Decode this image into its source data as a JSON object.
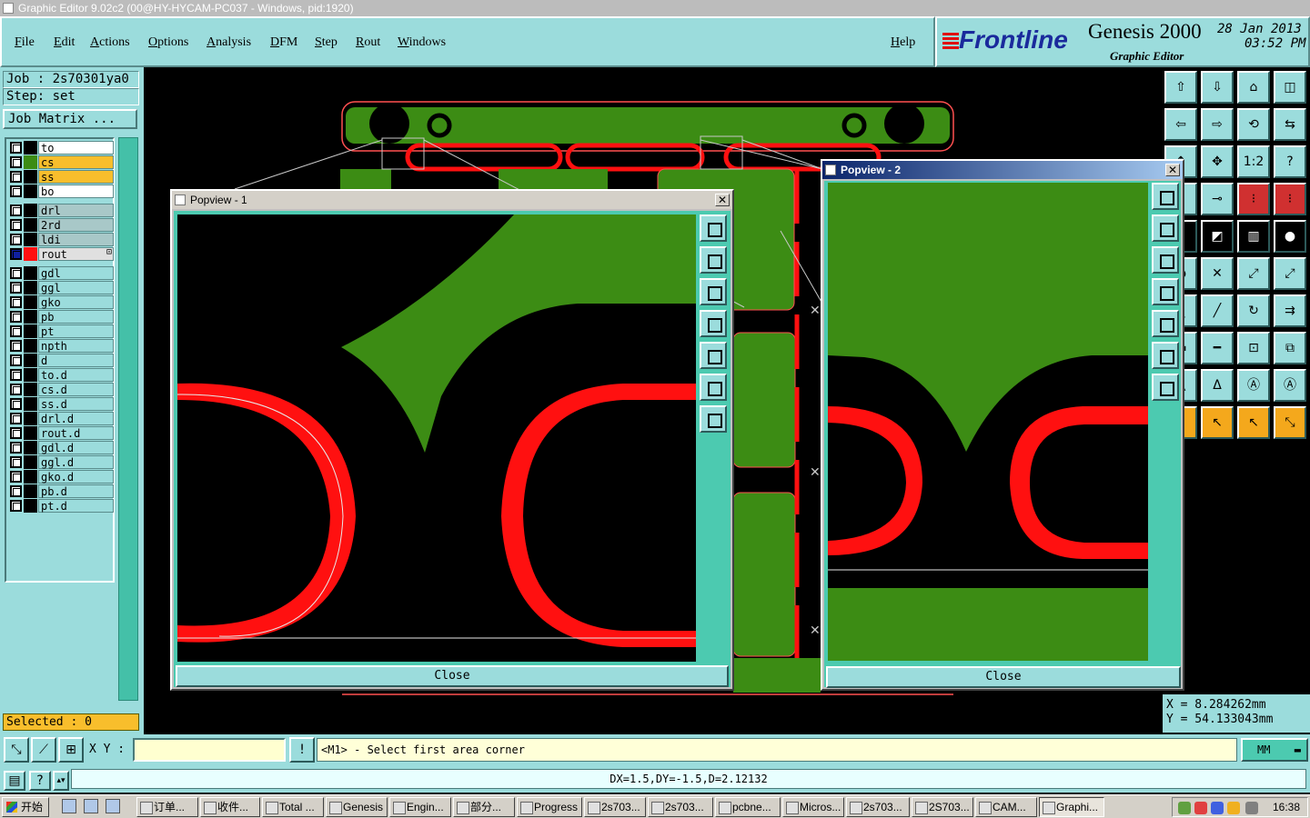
{
  "window": {
    "title": "Graphic Editor 9.02c2 (00@HY-HYCAM-PC037 - Windows, pid:1920)"
  },
  "menu": {
    "items": [
      "File",
      "Edit",
      "Actions",
      "Options",
      "Analysis",
      "DFM",
      "Step",
      "Rout",
      "Windows"
    ],
    "help": "Help"
  },
  "brand": {
    "logo": "Frontline",
    "product": "Genesis 2000",
    "subtitle": "Graphic Editor",
    "date": "28 Jan 2013",
    "time": "03:52 PM"
  },
  "job": {
    "job_line": "Job : 2s70301ya0",
    "step_line": "Step: set",
    "matrix_button": "Job Matrix ..."
  },
  "layers": {
    "group1": [
      {
        "name": "to",
        "color": "#000000",
        "bg": "#ffffff"
      },
      {
        "name": "cs",
        "color": "#3c8c14",
        "bg": "#f8be2c"
      },
      {
        "name": "ss",
        "color": "#000000",
        "bg": "#f8be2c"
      },
      {
        "name": "bo",
        "color": "#000000",
        "bg": "#ffffff"
      }
    ],
    "group2": [
      {
        "name": "drl",
        "color": "#000000",
        "bg": "#a8c8c8"
      },
      {
        "name": "2rd",
        "color": "#000000",
        "bg": "#a8c8c8"
      },
      {
        "name": "ldi",
        "color": "#000000",
        "bg": "#a8c8c8"
      },
      {
        "name": "rout",
        "color": "#ff1010",
        "bg": "#e0e0e0",
        "active": true,
        "marker": "⊡"
      }
    ],
    "group3": [
      "gdl",
      "ggl",
      "gko",
      "pb",
      "pt",
      "npth",
      "d",
      "to.d",
      "cs.d",
      "ss.d",
      "drl.d",
      "rout.d",
      "gdl.d",
      "ggl.d",
      "gko.d",
      "pb.d",
      "pt.d"
    ]
  },
  "status": {
    "selected": "Selected : 0"
  },
  "coords": {
    "x": "X  =  8.284262mm",
    "y": "Y  =  54.133043mm"
  },
  "popview1": {
    "title": "Popview - 1",
    "close": "Close"
  },
  "popview2": {
    "title": "Popview - 2",
    "close": "Close"
  },
  "cmd": {
    "xy_label": "X Y :",
    "xy_value": "",
    "message": "<M1> - Select first area corner",
    "units": "MM",
    "status": "DX=1.5,DY=-1.5,D=2.12132"
  },
  "taskbar": {
    "start": "开始",
    "tasks": [
      "订单...",
      "收件...",
      "Total ...",
      "Genesis",
      "Engin...",
      "部分...",
      "Progress",
      "2s703...",
      "2s703...",
      "pcbne...",
      "Micros...",
      "2s703...",
      "2S703...",
      "CAM...",
      "Graphi..."
    ],
    "clock": "16:38"
  },
  "colors": {
    "accent": "#9bdcdc",
    "copper": "#3c8c14",
    "rout": "#ff1010",
    "highlight": "#f8be2c"
  }
}
